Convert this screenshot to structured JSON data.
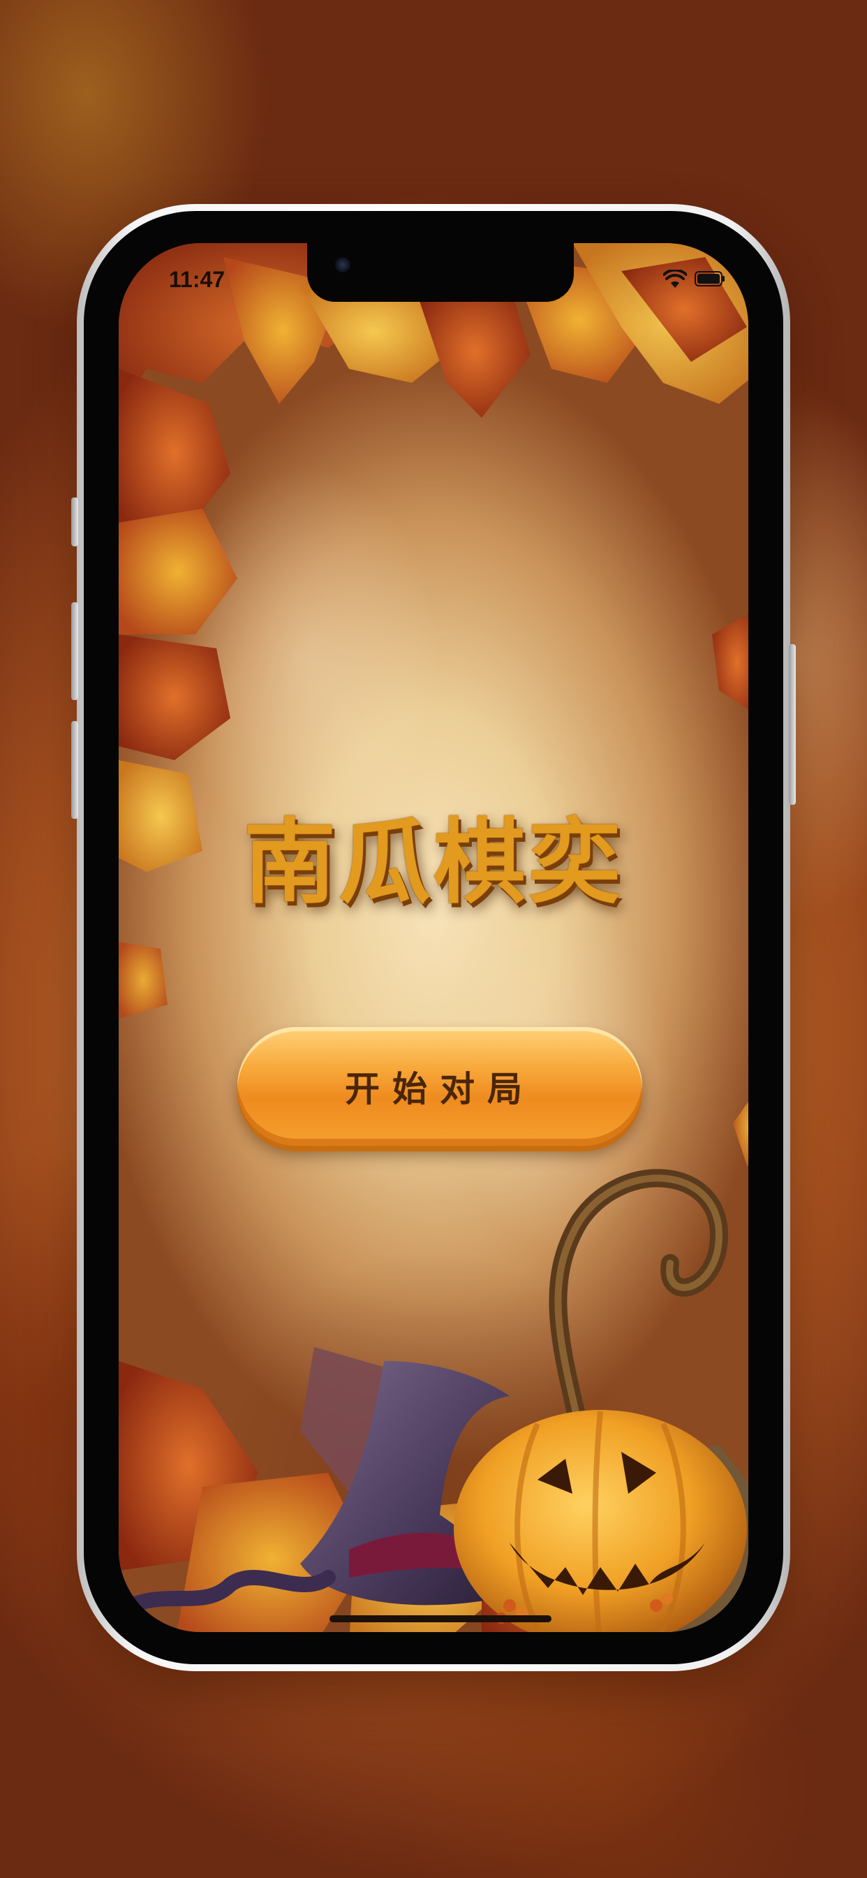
{
  "status_bar": {
    "time": "11:47",
    "icons": [
      "wifi-icon",
      "battery-icon"
    ]
  },
  "app": {
    "title": "南瓜棋奕",
    "start_button_label": "开始对局"
  },
  "theme": {
    "title_color": "#e29a1f",
    "button_color": "#f8a83a",
    "button_text_color": "#4a2608"
  },
  "decorations": [
    "autumn-leaves",
    "witch-hat",
    "jack-o-lantern",
    "curly-vine"
  ]
}
